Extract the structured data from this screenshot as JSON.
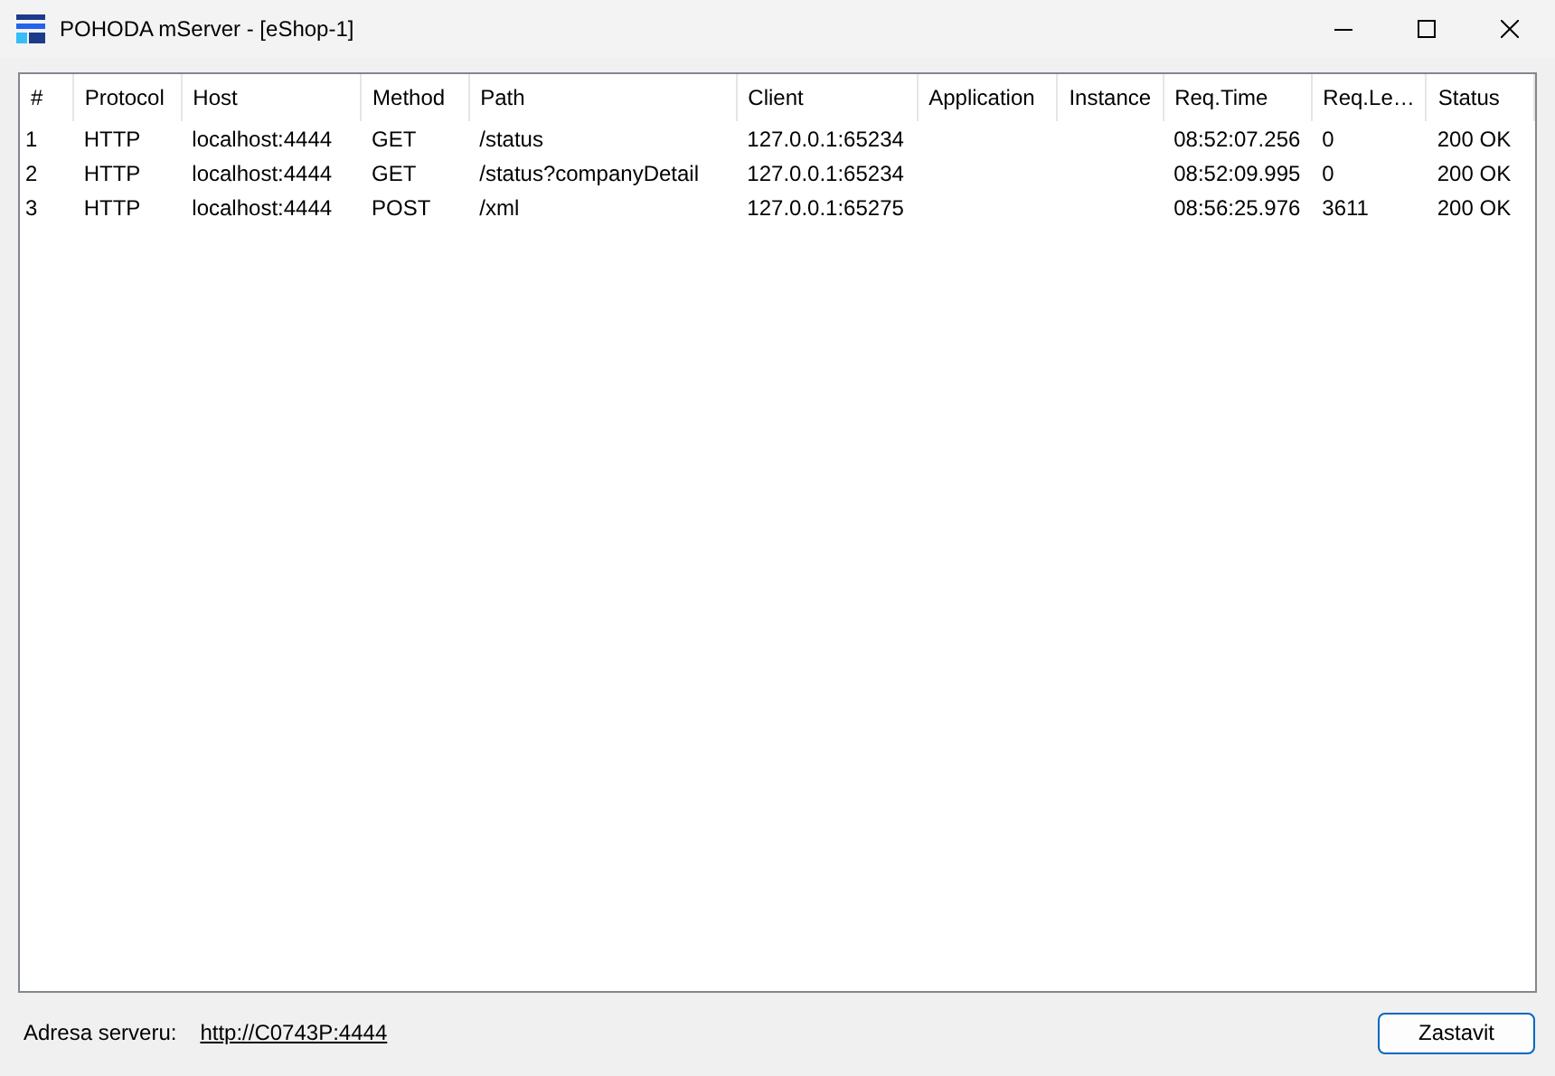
{
  "window": {
    "title": "POHODA mServer - [eShop-1]"
  },
  "table": {
    "columns": [
      "#",
      "Protocol",
      "Host",
      "Method",
      "Path",
      "Client",
      "Application",
      "Instance",
      "Req.Time",
      "Req.Le…",
      "Status"
    ],
    "rows": [
      [
        "1",
        "HTTP",
        "localhost:4444",
        "GET",
        "/status",
        "127.0.0.1:65234",
        "",
        "",
        "08:52:07.256",
        "0",
        "200 OK"
      ],
      [
        "2",
        "HTTP",
        "localhost:4444",
        "GET",
        "/status?companyDetail",
        "127.0.0.1:65234",
        "",
        "",
        "08:52:09.995",
        "0",
        "200 OK"
      ],
      [
        "3",
        "HTTP",
        "localhost:4444",
        "POST",
        "/xml",
        "127.0.0.1:65275",
        "",
        "",
        "08:56:25.976",
        "3611",
        "200 OK"
      ]
    ]
  },
  "footer": {
    "label": "Adresa serveru:",
    "link": "http://C0743P:4444",
    "button": "Zastavit"
  }
}
